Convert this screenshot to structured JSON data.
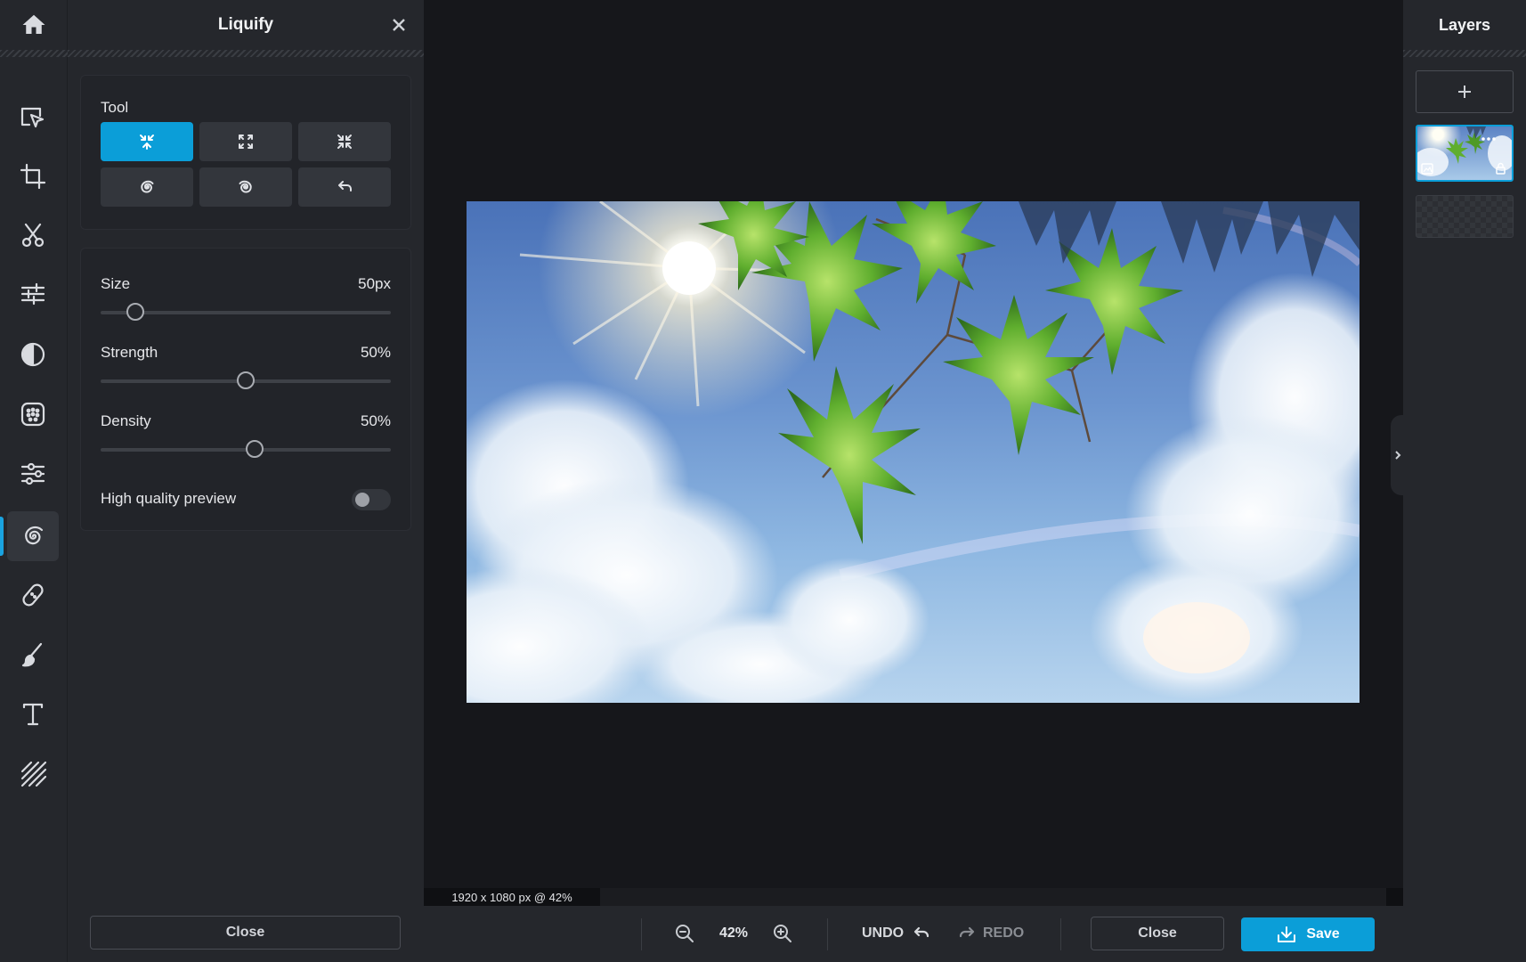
{
  "app": {
    "panel_title": "Liquify",
    "layers_title": "Layers",
    "accent_color": "#0b9ed8"
  },
  "rail": {
    "items": [
      {
        "icon": "home-icon",
        "name": "home"
      },
      {
        "icon": "select-arrow-icon",
        "name": "arrange"
      },
      {
        "icon": "crop-icon",
        "name": "crop"
      },
      {
        "icon": "scissors-icon",
        "name": "cutout"
      },
      {
        "icon": "sliders-icon",
        "name": "adjust"
      },
      {
        "icon": "contrast-icon",
        "name": "effects"
      },
      {
        "icon": "dots-grid-icon",
        "name": "filters"
      },
      {
        "icon": "retouch-icon",
        "name": "retouch"
      },
      {
        "icon": "spiral-icon",
        "name": "liquify",
        "active": true
      },
      {
        "icon": "bandage-icon",
        "name": "heal"
      },
      {
        "icon": "brush-icon",
        "name": "draw"
      },
      {
        "icon": "text-icon",
        "name": "text"
      },
      {
        "icon": "stripes-icon",
        "name": "overlay"
      }
    ]
  },
  "liquify": {
    "tool_label": "Tool",
    "tools": [
      {
        "icon": "push-icon",
        "active": true
      },
      {
        "icon": "expand-icon",
        "active": false
      },
      {
        "icon": "shrink-icon",
        "active": false
      },
      {
        "icon": "twirl-right-icon",
        "active": false
      },
      {
        "icon": "twirl-left-icon",
        "active": false
      },
      {
        "icon": "undo-icon",
        "active": false
      }
    ],
    "size_label": "Size",
    "size_value": "50px",
    "size_fraction": 0.12,
    "strength_label": "Strength",
    "strength_value": "50%",
    "strength_fraction": 0.5,
    "density_label": "Density",
    "density_value": "50%",
    "density_fraction": 0.53,
    "hq_label": "High quality preview",
    "hq_on": false,
    "close_label": "Close"
  },
  "canvas": {
    "size_readout": "1920 x 1080 px @ 42%"
  },
  "bottombar": {
    "zoom": "42%",
    "undo_label": "UNDO",
    "redo_label": "REDO",
    "close_label": "Close",
    "save_label": "Save"
  }
}
